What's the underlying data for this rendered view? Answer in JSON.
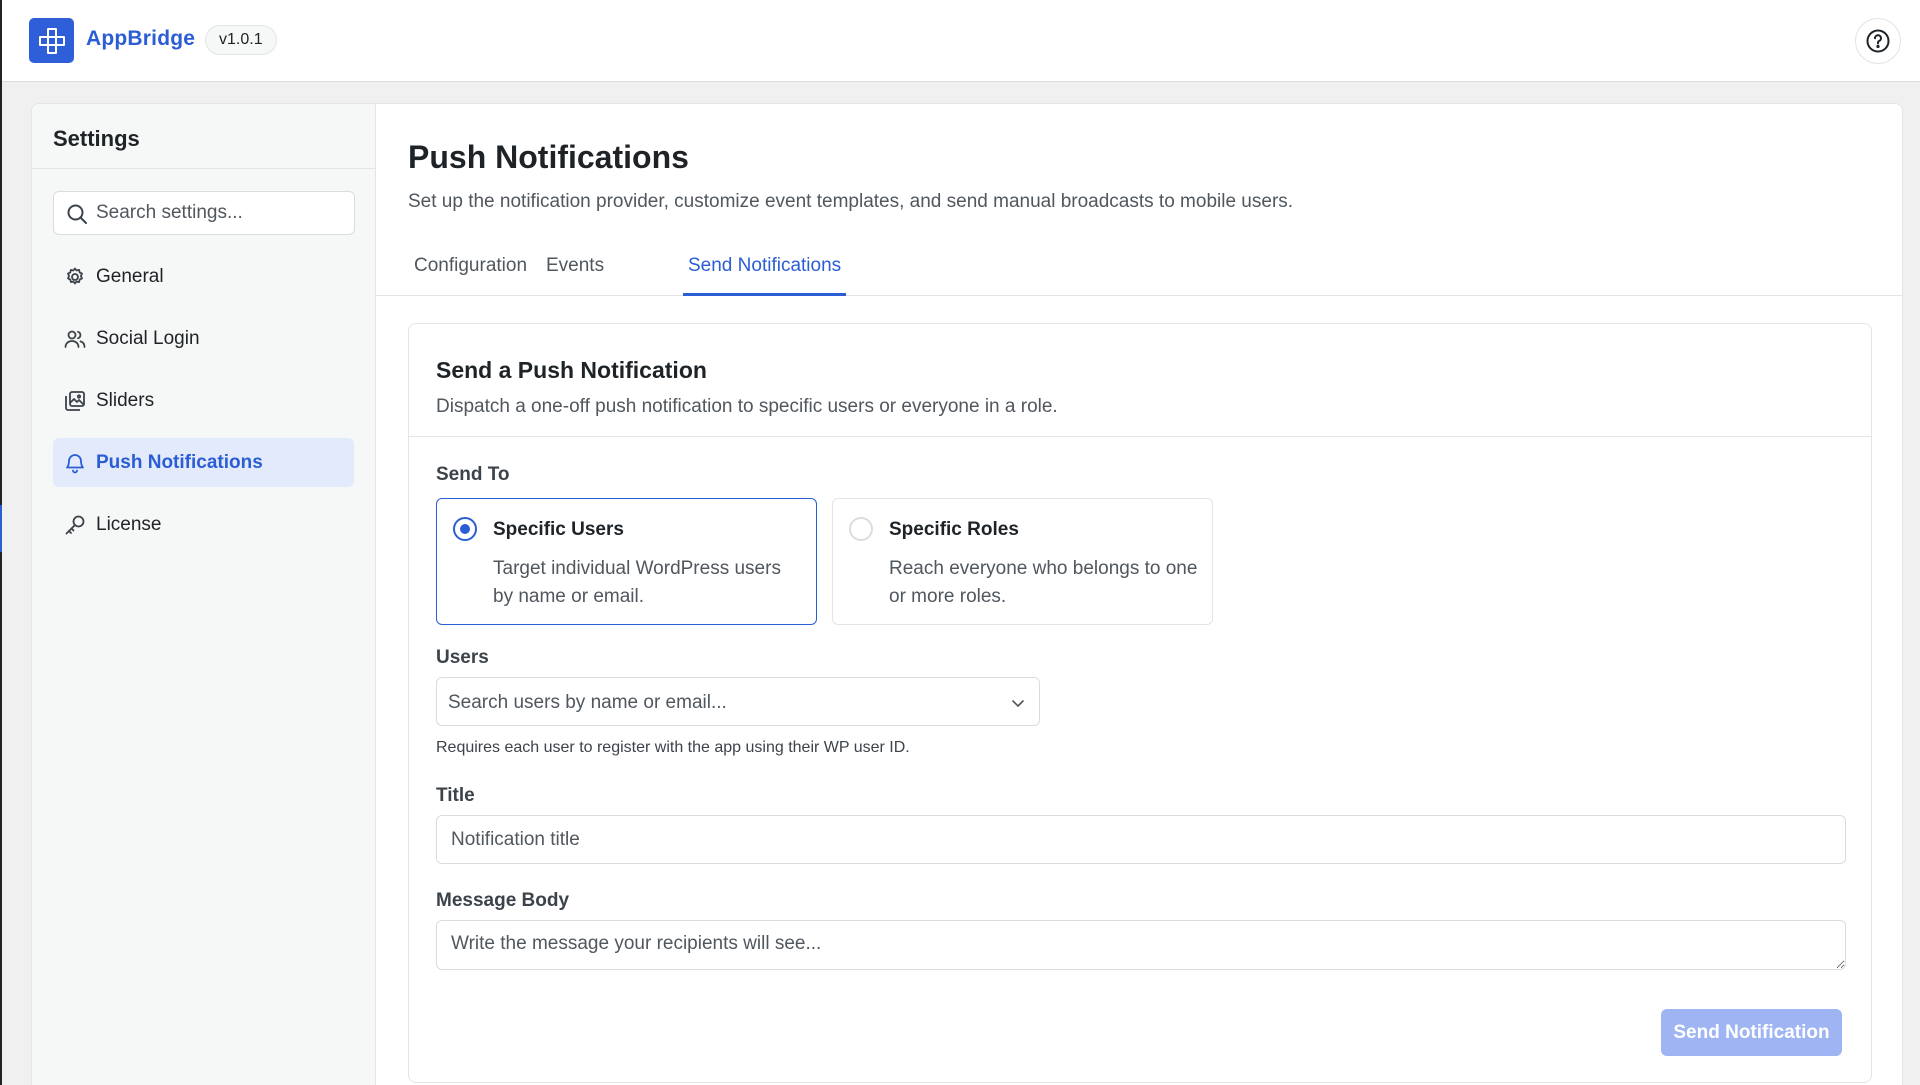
{
  "app": {
    "name": "AppBridge",
    "version": "v1.0.1"
  },
  "sidebar": {
    "title": "Settings",
    "search_placeholder": "Search settings...",
    "items": [
      {
        "label": "General",
        "icon": "gear-icon"
      },
      {
        "label": "Social Login",
        "icon": "users-icon"
      },
      {
        "label": "Sliders",
        "icon": "images-icon"
      },
      {
        "label": "Push Notifications",
        "icon": "bell-icon",
        "active": true
      },
      {
        "label": "License",
        "icon": "key-icon"
      }
    ]
  },
  "page": {
    "title": "Push Notifications",
    "subtitle": "Set up the notification provider, customize event templates, and send manual broadcasts to mobile users.",
    "tabs": [
      {
        "label": "Configuration"
      },
      {
        "label": "Events"
      },
      {
        "label": "Send Notifications",
        "active": true
      }
    ]
  },
  "panel": {
    "title": "Send a Push Notification",
    "description": "Dispatch a one-off push notification to specific users or everyone in a role.",
    "send_to_label": "Send To",
    "options": [
      {
        "title": "Specific Users",
        "description": "Target individual WordPress users by name or email.",
        "selected": true
      },
      {
        "title": "Specific Roles",
        "description": "Reach everyone who belongs to one or more roles.",
        "selected": false
      }
    ],
    "users_label": "Users",
    "users_placeholder": "Search users by name or email...",
    "users_help": "Requires each user to register with the app using their WP user ID.",
    "title_label": "Title",
    "title_placeholder": "Notification title",
    "message_label": "Message Body",
    "message_placeholder": "Write the message your recipients will see...",
    "send_button": "Send Notification"
  },
  "colors": {
    "accent": "#2b5dd4",
    "accent_light": "#e3eafb",
    "button_disabled": "#9fb5f3"
  }
}
